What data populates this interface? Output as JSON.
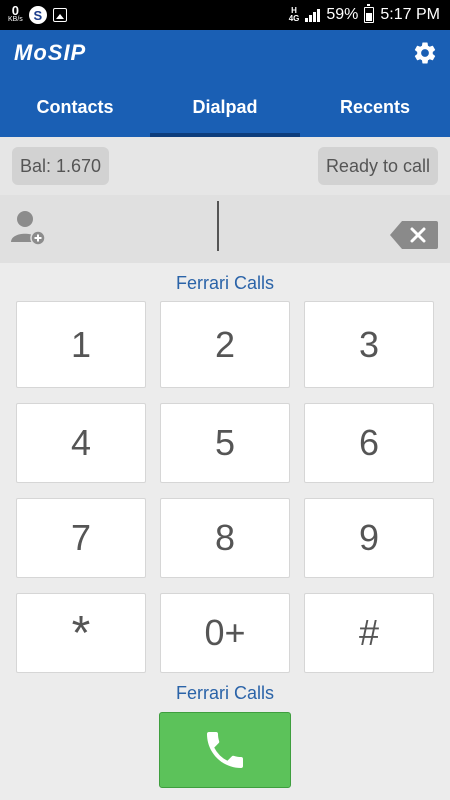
{
  "status_bar": {
    "speed_value": "0",
    "speed_unit": "KB/s",
    "notif_icons": [
      "s-app-icon",
      "image-icon"
    ],
    "network_type": "H",
    "network_sub": "4G",
    "battery": "59%",
    "time": "5:17 PM"
  },
  "app": {
    "logo": "MoSIP",
    "tabs": [
      "Contacts",
      "Dialpad",
      "Recents"
    ],
    "active_tab": "Dialpad",
    "accent": "#1a5fb4"
  },
  "info": {
    "balance": "Bal: 1.670",
    "status": "Ready to call"
  },
  "dial": {
    "number": "",
    "provider_top": "Ferrari Calls",
    "provider_bottom": "Ferrari Calls",
    "keys": [
      "1",
      "2",
      "3",
      "4",
      "5",
      "6",
      "7",
      "8",
      "9",
      "*",
      "0+",
      "#"
    ],
    "call_color": "#5cc25a"
  }
}
